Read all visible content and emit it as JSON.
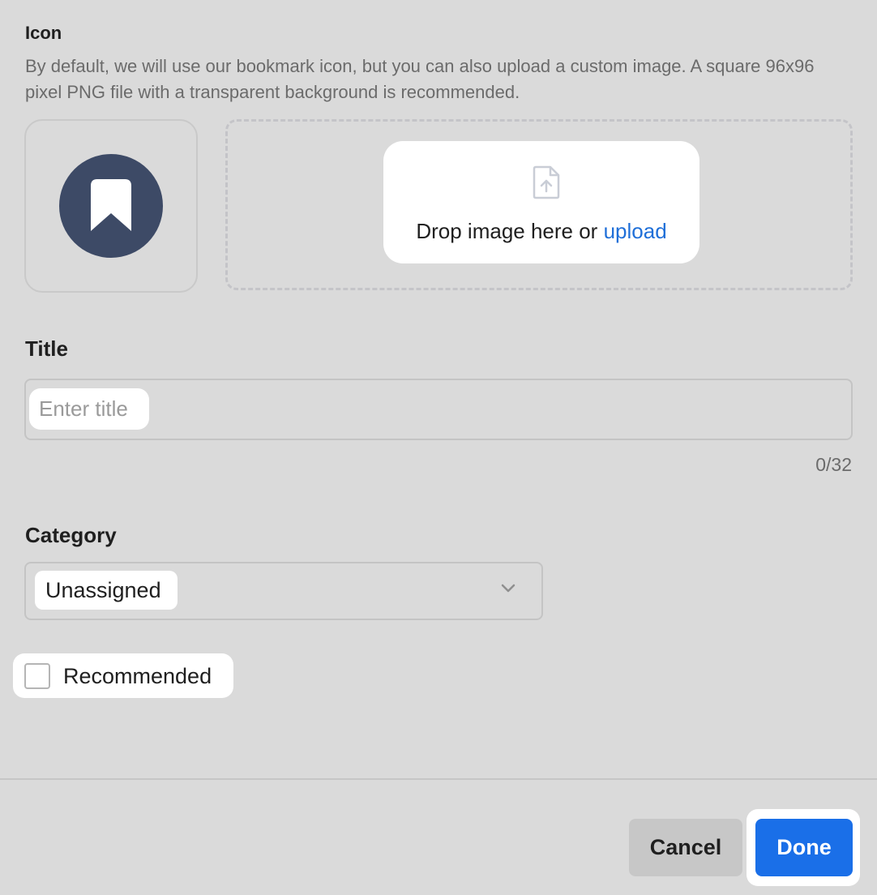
{
  "icon_section": {
    "label": "Icon",
    "description": "By default, we will use our bookmark icon, but you can also upload a custom image. A square 96x96 pixel PNG file with a transparent background is recommended.",
    "preview_icon": "bookmark-icon",
    "dropzone": {
      "text": "Drop image here or ",
      "link_text": "upload",
      "icon": "file-upload-icon"
    }
  },
  "title_section": {
    "label": "Title",
    "placeholder": "Enter title",
    "value": "",
    "char_count": "0/32"
  },
  "category_section": {
    "label": "Category",
    "selected": "Unassigned"
  },
  "recommended": {
    "label": "Recommended",
    "checked": false
  },
  "footer": {
    "cancel_label": "Cancel",
    "done_label": "Done"
  },
  "colors": {
    "background": "#dadada",
    "accent": "#1a6fe8",
    "link": "#1f6fd8",
    "icon_badge": "#3d4a66"
  }
}
